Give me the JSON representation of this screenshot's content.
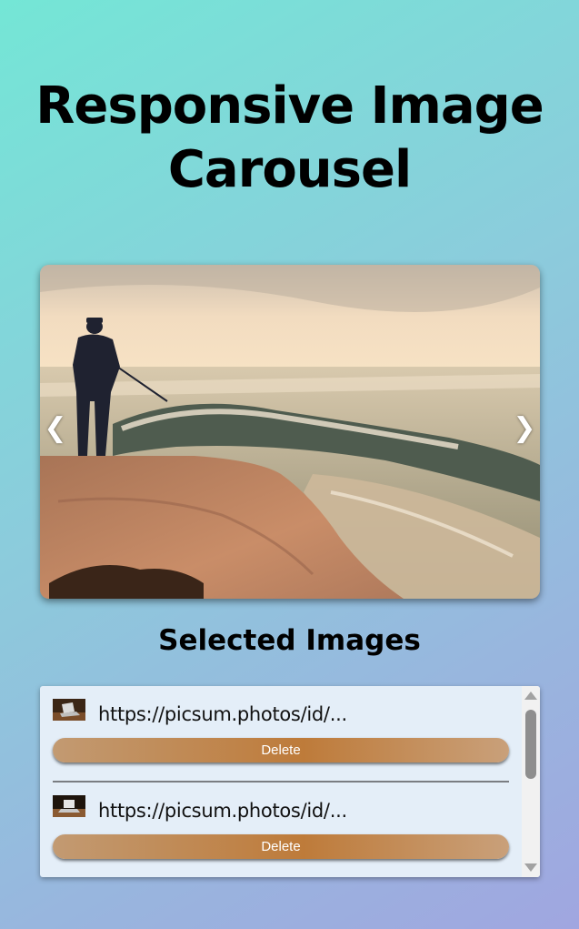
{
  "page": {
    "title": "Responsive Image Carousel"
  },
  "carousel": {
    "prev_glyph": "❮",
    "next_glyph": "❯",
    "image_subject": "fisherman standing on rocky shore at sunset with waves"
  },
  "selected": {
    "heading": "Selected Images",
    "items": [
      {
        "url": "https://picsum.photos/id/...",
        "delete_label": "Delete",
        "thumb": "laptop-on-desk"
      },
      {
        "url": "https://picsum.photos/id/...",
        "delete_label": "Delete",
        "thumb": "laptop-on-desk"
      }
    ]
  },
  "colors": {
    "bg_start": "#74e6d6",
    "bg_end": "#a0a6e0",
    "delete_button": "#be7b3a",
    "list_bg": "#e4eef8"
  }
}
